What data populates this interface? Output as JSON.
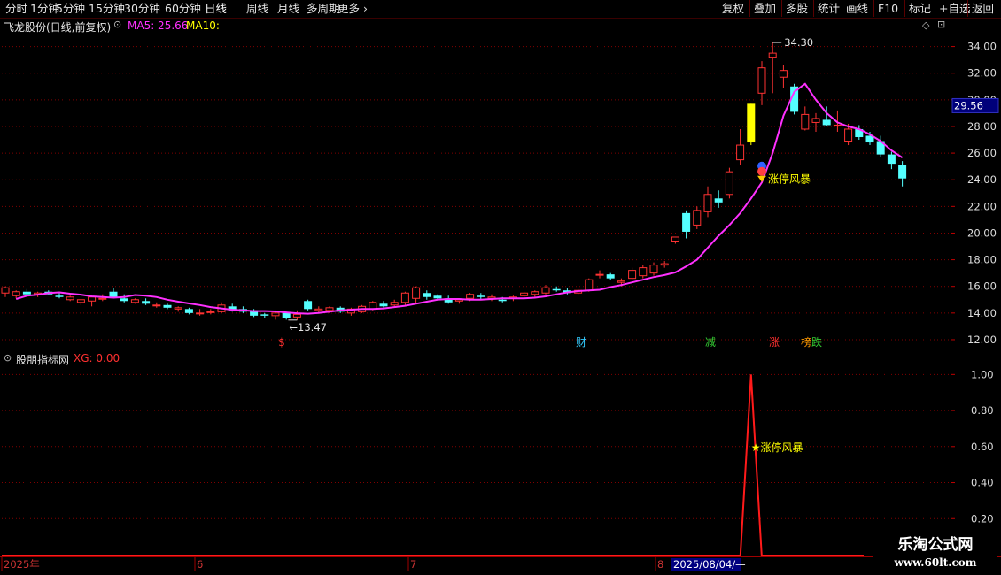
{
  "toolbar": {
    "periods": [
      "分时",
      "1分钟",
      "5分钟",
      "15分钟",
      "30分钟",
      "60分钟",
      "日线",
      "周线",
      "月线",
      "多周期",
      "更多"
    ],
    "active": "日线",
    "right_buttons": [
      "复权",
      "叠加",
      "多股",
      "统计",
      "画线",
      "F10",
      "标记",
      "+自选",
      "返回"
    ]
  },
  "main_pane": {
    "title": "飞龙股份(日线,前复权)",
    "ma5_label": "MA5: 25.66",
    "ma10_label": "MA10:",
    "high_label": "34.30",
    "low_label": "13.47",
    "price_tag": "29.56",
    "signal_label": "涨停风暴",
    "event_markers": [
      {
        "text": "$",
        "color": "#ff3030"
      },
      {
        "text": "财",
        "color": "#33ccff"
      },
      {
        "text": "减",
        "color": "#33cc33"
      },
      {
        "text": "涨",
        "color": "#ff3030"
      },
      {
        "text": "榜",
        "color": "#ff9900"
      },
      {
        "text": "跌",
        "color": "#33cc33"
      }
    ]
  },
  "indicator_pane": {
    "title": "股朋指标网",
    "xg_label": "XG: 0.00",
    "signal_label": "★涨停风暴"
  },
  "date_axis": {
    "labels": [
      "2025年",
      "6",
      "7",
      "8"
    ],
    "cursor_date": "2025/08/04/—"
  },
  "watermark": {
    "line1": "乐淘公式网",
    "line2": "www.60lt.com"
  },
  "colors": {
    "up": "#ff3232",
    "down": "#54ffff",
    "ma5": "#ff30ff",
    "xg": "#ff1a1a",
    "limit_up": "#ffff00",
    "grid": "#800000"
  },
  "chart_data": {
    "type": "candlestick",
    "price_axis": {
      "ticks": [
        12.0,
        14.0,
        16.0,
        18.0,
        20.0,
        22.0,
        24.0,
        26.0,
        28.0,
        30.0,
        32.0,
        34.0
      ],
      "range": [
        11.4,
        35.3
      ]
    },
    "indicator_axis": {
      "ticks": [
        0.2,
        0.4,
        0.6,
        0.8,
        1.0
      ],
      "range": [
        0,
        1.09
      ]
    },
    "candles": [
      {
        "o": 15.5,
        "h": 16.0,
        "l": 15.2,
        "c": 15.9
      },
      {
        "o": 15.3,
        "h": 15.7,
        "l": 15.1,
        "c": 15.6
      },
      {
        "o": 15.6,
        "h": 15.8,
        "l": 15.3,
        "c": 15.4
      },
      {
        "o": 15.4,
        "h": 15.6,
        "l": 15.2,
        "c": 15.5
      },
      {
        "o": 15.6,
        "h": 15.7,
        "l": 15.4,
        "c": 15.4
      },
      {
        "o": 15.3,
        "h": 15.5,
        "l": 15.1,
        "c": 15.2
      },
      {
        "o": 15.0,
        "h": 15.3,
        "l": 14.9,
        "c": 15.2
      },
      {
        "o": 14.8,
        "h": 15.0,
        "l": 14.6,
        "c": 15.0
      },
      {
        "o": 14.9,
        "h": 15.3,
        "l": 14.5,
        "c": 15.2
      },
      {
        "o": 15.1,
        "h": 15.4,
        "l": 14.9,
        "c": 15.1
      },
      {
        "o": 15.6,
        "h": 15.9,
        "l": 15.1,
        "c": 15.2
      },
      {
        "o": 15.1,
        "h": 15.4,
        "l": 14.8,
        "c": 14.9
      },
      {
        "o": 14.8,
        "h": 15.1,
        "l": 14.7,
        "c": 15.0
      },
      {
        "o": 14.9,
        "h": 15.1,
        "l": 14.6,
        "c": 14.7
      },
      {
        "o": 14.6,
        "h": 14.8,
        "l": 14.4,
        "c": 14.6
      },
      {
        "o": 14.6,
        "h": 14.7,
        "l": 14.3,
        "c": 14.4
      },
      {
        "o": 14.3,
        "h": 14.5,
        "l": 14.1,
        "c": 14.4
      },
      {
        "o": 14.3,
        "h": 14.4,
        "l": 13.9,
        "c": 14.0
      },
      {
        "o": 14.0,
        "h": 14.3,
        "l": 13.8,
        "c": 14.0
      },
      {
        "o": 14.1,
        "h": 14.3,
        "l": 13.9,
        "c": 14.1
      },
      {
        "o": 14.1,
        "h": 14.8,
        "l": 14.0,
        "c": 14.6
      },
      {
        "o": 14.5,
        "h": 14.7,
        "l": 14.1,
        "c": 14.2
      },
      {
        "o": 14.3,
        "h": 14.5,
        "l": 14.0,
        "c": 14.1
      },
      {
        "o": 14.2,
        "h": 14.3,
        "l": 13.7,
        "c": 13.8
      },
      {
        "o": 13.9,
        "h": 14.0,
        "l": 13.6,
        "c": 13.8
      },
      {
        "o": 13.8,
        "h": 14.2,
        "l": 13.5,
        "c": 14.0
      },
      {
        "o": 14.0,
        "h": 14.1,
        "l": 13.5,
        "c": 13.6
      },
      {
        "o": 13.7,
        "h": 14.2,
        "l": 13.47,
        "c": 13.9
      },
      {
        "o": 14.9,
        "h": 15.0,
        "l": 14.2,
        "c": 14.3
      },
      {
        "o": 14.2,
        "h": 14.5,
        "l": 14.0,
        "c": 14.3
      },
      {
        "o": 14.2,
        "h": 14.5,
        "l": 14.0,
        "c": 14.4
      },
      {
        "o": 14.4,
        "h": 14.5,
        "l": 14.0,
        "c": 14.1
      },
      {
        "o": 14.0,
        "h": 14.4,
        "l": 13.8,
        "c": 14.3
      },
      {
        "o": 14.1,
        "h": 14.6,
        "l": 14.0,
        "c": 14.5
      },
      {
        "o": 14.3,
        "h": 14.9,
        "l": 14.2,
        "c": 14.8
      },
      {
        "o": 14.7,
        "h": 14.9,
        "l": 14.4,
        "c": 14.5
      },
      {
        "o": 14.6,
        "h": 15.0,
        "l": 14.4,
        "c": 14.8
      },
      {
        "o": 14.8,
        "h": 15.6,
        "l": 14.6,
        "c": 15.5
      },
      {
        "o": 15.1,
        "h": 16.0,
        "l": 14.7,
        "c": 15.9
      },
      {
        "o": 15.5,
        "h": 15.7,
        "l": 15.0,
        "c": 15.2
      },
      {
        "o": 15.3,
        "h": 15.4,
        "l": 15.0,
        "c": 15.1
      },
      {
        "o": 15.1,
        "h": 15.3,
        "l": 14.7,
        "c": 14.8
      },
      {
        "o": 14.9,
        "h": 15.1,
        "l": 14.7,
        "c": 15.0
      },
      {
        "o": 15.1,
        "h": 15.5,
        "l": 14.9,
        "c": 15.4
      },
      {
        "o": 15.3,
        "h": 15.5,
        "l": 15.0,
        "c": 15.2
      },
      {
        "o": 15.1,
        "h": 15.4,
        "l": 14.9,
        "c": 15.2
      },
      {
        "o": 15.0,
        "h": 15.2,
        "l": 14.8,
        "c": 14.9
      },
      {
        "o": 15.1,
        "h": 15.3,
        "l": 14.9,
        "c": 15.2
      },
      {
        "o": 15.3,
        "h": 15.6,
        "l": 15.1,
        "c": 15.5
      },
      {
        "o": 15.4,
        "h": 15.7,
        "l": 15.2,
        "c": 15.6
      },
      {
        "o": 15.5,
        "h": 16.1,
        "l": 15.4,
        "c": 15.9
      },
      {
        "o": 15.8,
        "h": 16.0,
        "l": 15.6,
        "c": 15.7
      },
      {
        "o": 15.7,
        "h": 15.9,
        "l": 15.4,
        "c": 15.5
      },
      {
        "o": 15.5,
        "h": 15.8,
        "l": 15.4,
        "c": 15.7
      },
      {
        "o": 15.7,
        "h": 16.6,
        "l": 15.6,
        "c": 16.5
      },
      {
        "o": 16.9,
        "h": 17.2,
        "l": 16.6,
        "c": 16.9
      },
      {
        "o": 16.9,
        "h": 17.0,
        "l": 16.5,
        "c": 16.6
      },
      {
        "o": 16.3,
        "h": 16.6,
        "l": 16.0,
        "c": 16.4
      },
      {
        "o": 16.6,
        "h": 17.4,
        "l": 16.5,
        "c": 17.2
      },
      {
        "o": 16.8,
        "h": 17.6,
        "l": 16.6,
        "c": 17.4
      },
      {
        "o": 17.0,
        "h": 17.8,
        "l": 16.8,
        "c": 17.6
      },
      {
        "o": 17.6,
        "h": 17.9,
        "l": 17.4,
        "c": 17.7
      },
      {
        "o": 19.4,
        "h": 19.7,
        "l": 19.2,
        "c": 19.7
      },
      {
        "o": 21.5,
        "h": 21.7,
        "l": 19.6,
        "c": 20.1
      },
      {
        "o": 20.6,
        "h": 22.0,
        "l": 20.3,
        "c": 21.7
      },
      {
        "o": 21.6,
        "h": 23.5,
        "l": 21.2,
        "c": 22.9
      },
      {
        "o": 22.6,
        "h": 23.2,
        "l": 21.9,
        "c": 22.3
      },
      {
        "o": 22.9,
        "h": 24.9,
        "l": 22.6,
        "c": 24.6
      },
      {
        "o": 25.5,
        "h": 27.8,
        "l": 25.1,
        "c": 26.6
      },
      {
        "o": 26.8,
        "h": 29.7,
        "l": 26.6,
        "c": 29.7
      },
      {
        "o": 30.5,
        "h": 32.9,
        "l": 29.6,
        "c": 32.4
      },
      {
        "o": 33.2,
        "h": 34.3,
        "l": 30.5,
        "c": 33.5
      },
      {
        "o": 31.7,
        "h": 32.6,
        "l": 30.9,
        "c": 32.2
      },
      {
        "o": 31.0,
        "h": 31.2,
        "l": 28.9,
        "c": 29.1
      },
      {
        "o": 27.8,
        "h": 29.5,
        "l": 27.7,
        "c": 28.9
      },
      {
        "o": 28.3,
        "h": 29.0,
        "l": 27.6,
        "c": 28.6
      },
      {
        "o": 28.5,
        "h": 29.5,
        "l": 28.0,
        "c": 28.1
      },
      {
        "o": 28.1,
        "h": 29.2,
        "l": 27.6,
        "c": 28.1
      },
      {
        "o": 26.9,
        "h": 28.2,
        "l": 26.6,
        "c": 27.8
      },
      {
        "o": 27.8,
        "h": 28.1,
        "l": 27.0,
        "c": 27.2
      },
      {
        "o": 27.3,
        "h": 27.6,
        "l": 26.6,
        "c": 26.8
      },
      {
        "o": 26.9,
        "h": 27.3,
        "l": 25.7,
        "c": 25.9
      },
      {
        "o": 25.9,
        "h": 26.1,
        "l": 24.8,
        "c": 25.2
      },
      {
        "o": 25.1,
        "h": 25.4,
        "l": 23.5,
        "c": 24.1
      }
    ],
    "ma5": [
      15.05,
      15.3,
      15.38,
      15.5,
      15.55,
      15.45,
      15.38,
      15.25,
      15.2,
      15.15,
      15.2,
      15.35,
      15.3,
      15.2,
      15.0,
      14.85,
      14.72,
      14.6,
      14.45,
      14.35,
      14.25,
      14.2,
      14.15,
      14.15,
      14.12,
      14.05,
      13.98,
      13.95,
      14.0,
      14.1,
      14.2,
      14.25,
      14.3,
      14.3,
      14.35,
      14.45,
      14.55,
      14.7,
      14.85,
      15.0,
      15.05,
      15.05,
      15.0,
      15.0,
      15.05,
      15.1,
      15.1,
      15.1,
      15.15,
      15.25,
      15.4,
      15.55,
      15.65,
      15.7,
      15.75,
      15.95,
      16.1,
      16.3,
      16.5,
      16.7,
      16.85,
      17.05,
      17.5,
      18.0,
      18.9,
      19.8,
      20.6,
      21.5,
      22.6,
      23.8,
      26.0,
      28.8,
      30.6,
      31.2,
      30.0,
      29.0,
      28.3,
      28.0,
      27.8,
      27.4,
      26.9,
      26.2,
      25.66
    ],
    "xg": {
      "peak_index": 69,
      "value": 1.0
    }
  }
}
